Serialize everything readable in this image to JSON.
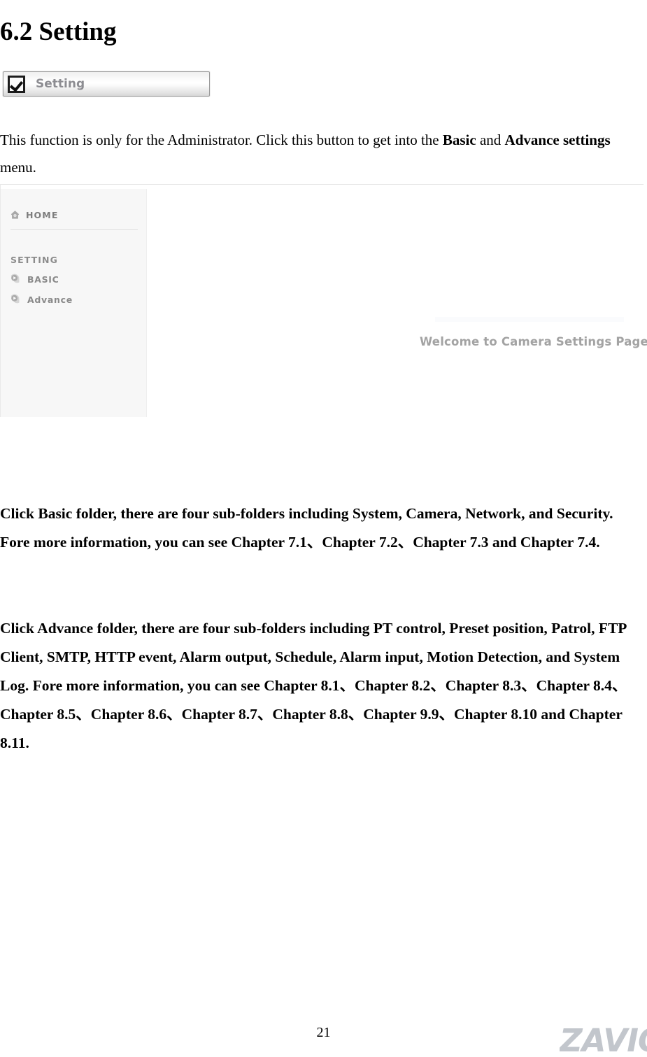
{
  "document": {
    "heading": "6.2 Setting",
    "page_number": "21",
    "brand_logo_text": "ZAVIO"
  },
  "setting_button": {
    "label": "Setting",
    "icon": "checkbox-checked-icon"
  },
  "paragraphs": {
    "intro_part1": "This function is only for the Administrator. Click this button to get into the ",
    "intro_bold1": "Basic",
    "intro_part2": " and ",
    "intro_bold2": "Advance settings",
    "intro_part3": " menu.",
    "basic": "Click Basic folder, there are four sub-folders including System, Camera, Network, and Security. Fore more information, you can see Chapter 7.1、Chapter 7.2、Chapter 7.3 and Chapter 7.4.",
    "advance": "Click Advance folder, there are four sub-folders including PT control, Preset position, Patrol, FTP Client, SMTP, HTTP event, Alarm output, Schedule, Alarm input, Motion Detection, and System Log. Fore more information, you can see Chapter 8.1、Chapter 8.2、Chapter 8.3、Chapter 8.4、Chapter 8.5、Chapter 8.6、Chapter 8.7、Chapter 8.8、Chapter 9.9、Chapter 8.10 and Chapter 8.11."
  },
  "screenshot": {
    "sidebar": {
      "home_label": "HOME",
      "home_icon": "home-icon",
      "section_title": "SETTING",
      "items": [
        {
          "label": "BASIC",
          "icon": "folder-arrow-icon"
        },
        {
          "label": "Advance",
          "icon": "folder-arrow-icon"
        }
      ]
    },
    "content": {
      "welcome_text": "Welcome to Camera Settings Page"
    }
  },
  "colors": {
    "sidebar_background": "#f7f7f7",
    "sidebar_text": "#8a8a8a",
    "welcome_text": "#a3a3a3",
    "logo": "#c2c6cc",
    "button_label": "#8d8d92"
  }
}
